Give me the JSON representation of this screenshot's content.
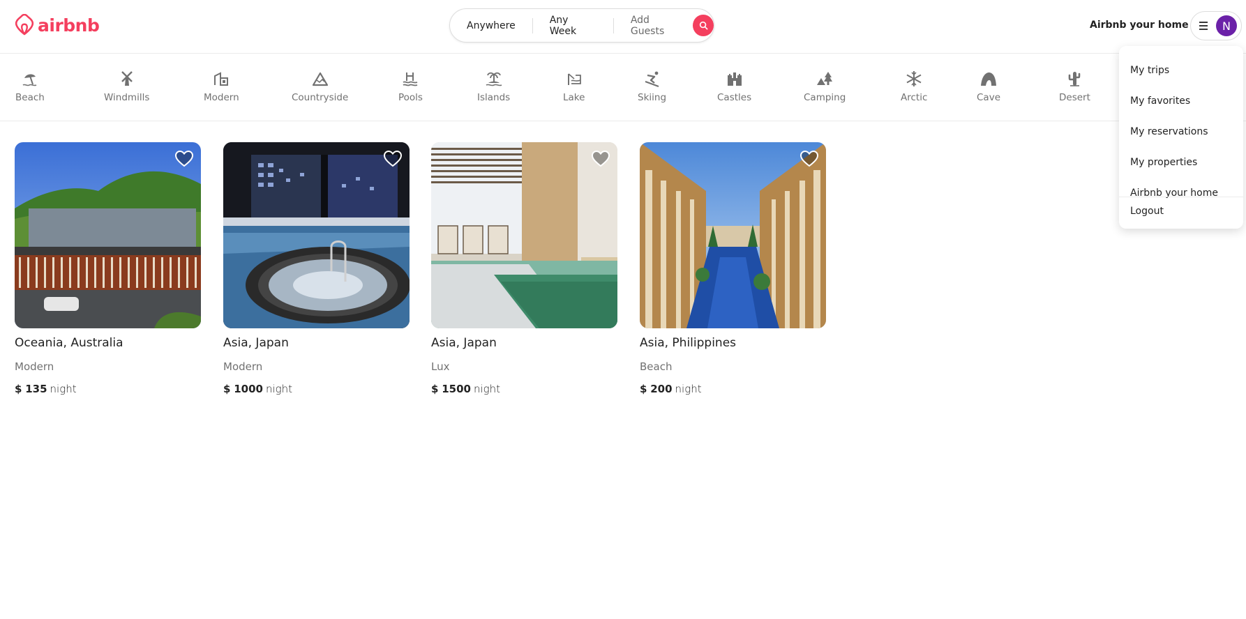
{
  "brand": {
    "name": "airbnb",
    "color": "#f43f5e"
  },
  "search": {
    "location": "Anywhere",
    "week": "Any Week",
    "guests": "Add Guests",
    "button_icon": "search-icon"
  },
  "header": {
    "host_link": "Airbnb your home",
    "menu_icon": "hamburger-icon",
    "avatar_initial": "N",
    "avatar_color": "#6b21a8"
  },
  "categories": [
    {
      "label": "Beach",
      "icon": "beach-icon"
    },
    {
      "label": "Windmills",
      "icon": "windmill-icon"
    },
    {
      "label": "Modern",
      "icon": "modern-house-icon"
    },
    {
      "label": "Countryside",
      "icon": "mountain-icon"
    },
    {
      "label": "Pools",
      "icon": "pool-icon"
    },
    {
      "label": "Islands",
      "icon": "island-icon"
    },
    {
      "label": "Lake",
      "icon": "lake-icon"
    },
    {
      "label": "Skiing",
      "icon": "skiing-icon"
    },
    {
      "label": "Castles",
      "icon": "castle-icon"
    },
    {
      "label": "Camping",
      "icon": "camping-icon"
    },
    {
      "label": "Arctic",
      "icon": "snowflake-icon"
    },
    {
      "label": "Cave",
      "icon": "cave-icon"
    },
    {
      "label": "Desert",
      "icon": "cactus-icon"
    }
  ],
  "user_menu": {
    "items": [
      "My trips",
      "My favorites",
      "My reservations",
      "My properties",
      "Airbnb your home"
    ],
    "logout": "Logout"
  },
  "listings": [
    {
      "location": "Oceania, Australia",
      "category": "Modern",
      "currency": "$",
      "price": "135",
      "unit": "night"
    },
    {
      "location": "Asia, Japan",
      "category": "Modern",
      "currency": "$",
      "price": "1000",
      "unit": "night"
    },
    {
      "location": "Asia, Japan",
      "category": "Lux",
      "currency": "$",
      "price": "1500",
      "unit": "night"
    },
    {
      "location": "Asia, Philippines",
      "category": "Beach",
      "currency": "$",
      "price": "200",
      "unit": "night"
    }
  ]
}
